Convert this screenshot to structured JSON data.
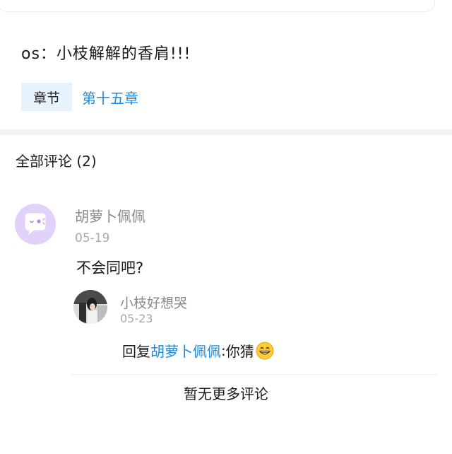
{
  "post": {
    "text": "os：小枝解解的香肩!!!",
    "chapter_tag": "章节",
    "chapter_link": "第十五章"
  },
  "comments_section": {
    "title": "全部评论 (2)",
    "comments": [
      {
        "author": "胡萝卜佩佩",
        "date": "05-19",
        "text": "不会同吧?",
        "avatar_icon": "chat-bubble-icon",
        "reply": {
          "author": "小枝好想哭",
          "date": "05-23",
          "prefix": "回复",
          "mention": "胡萝卜佩佩",
          "colon": ":",
          "text": "你猜",
          "emoji_icon": "grinning-face-emoji-icon",
          "avatar_icon": "photo-avatar"
        }
      }
    ],
    "no_more": "暂无更多评论"
  },
  "colors": {
    "accent_blue": "#1a8ce0",
    "tag_bg": "#e7f3fc",
    "avatar_purple": "#e0d2f8"
  }
}
